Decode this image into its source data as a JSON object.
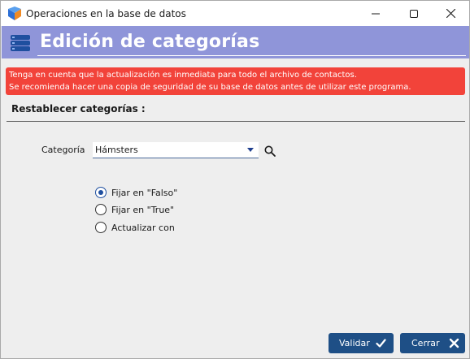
{
  "window": {
    "title": "Operaciones en la base de datos",
    "controls": [
      "minimize-icon",
      "maximize-icon",
      "close-icon"
    ]
  },
  "header": {
    "title": "Edición de categorías",
    "icon": "database-icon",
    "color": "#8f95d9"
  },
  "warning": {
    "line1": "Tenga en cuenta que la actualización es inmediata para todo el archivo de contactos.",
    "line2": "Se recomienda hacer una copia de seguridad de su base de datos antes de utilizar este programa.",
    "color": "#f2433a"
  },
  "section": {
    "title": "Restablecer categorías :"
  },
  "category": {
    "label": "Categoría",
    "value": "Hámsters"
  },
  "options": [
    {
      "label": "Fijar en \"Falso\"",
      "checked": true
    },
    {
      "label": "Fijar en \"True\"",
      "checked": false
    },
    {
      "label": "Actualizar con",
      "checked": false
    }
  ],
  "footer": {
    "validate_label": "Validar",
    "close_label": "Cerrar",
    "button_color": "#1e4f86"
  }
}
